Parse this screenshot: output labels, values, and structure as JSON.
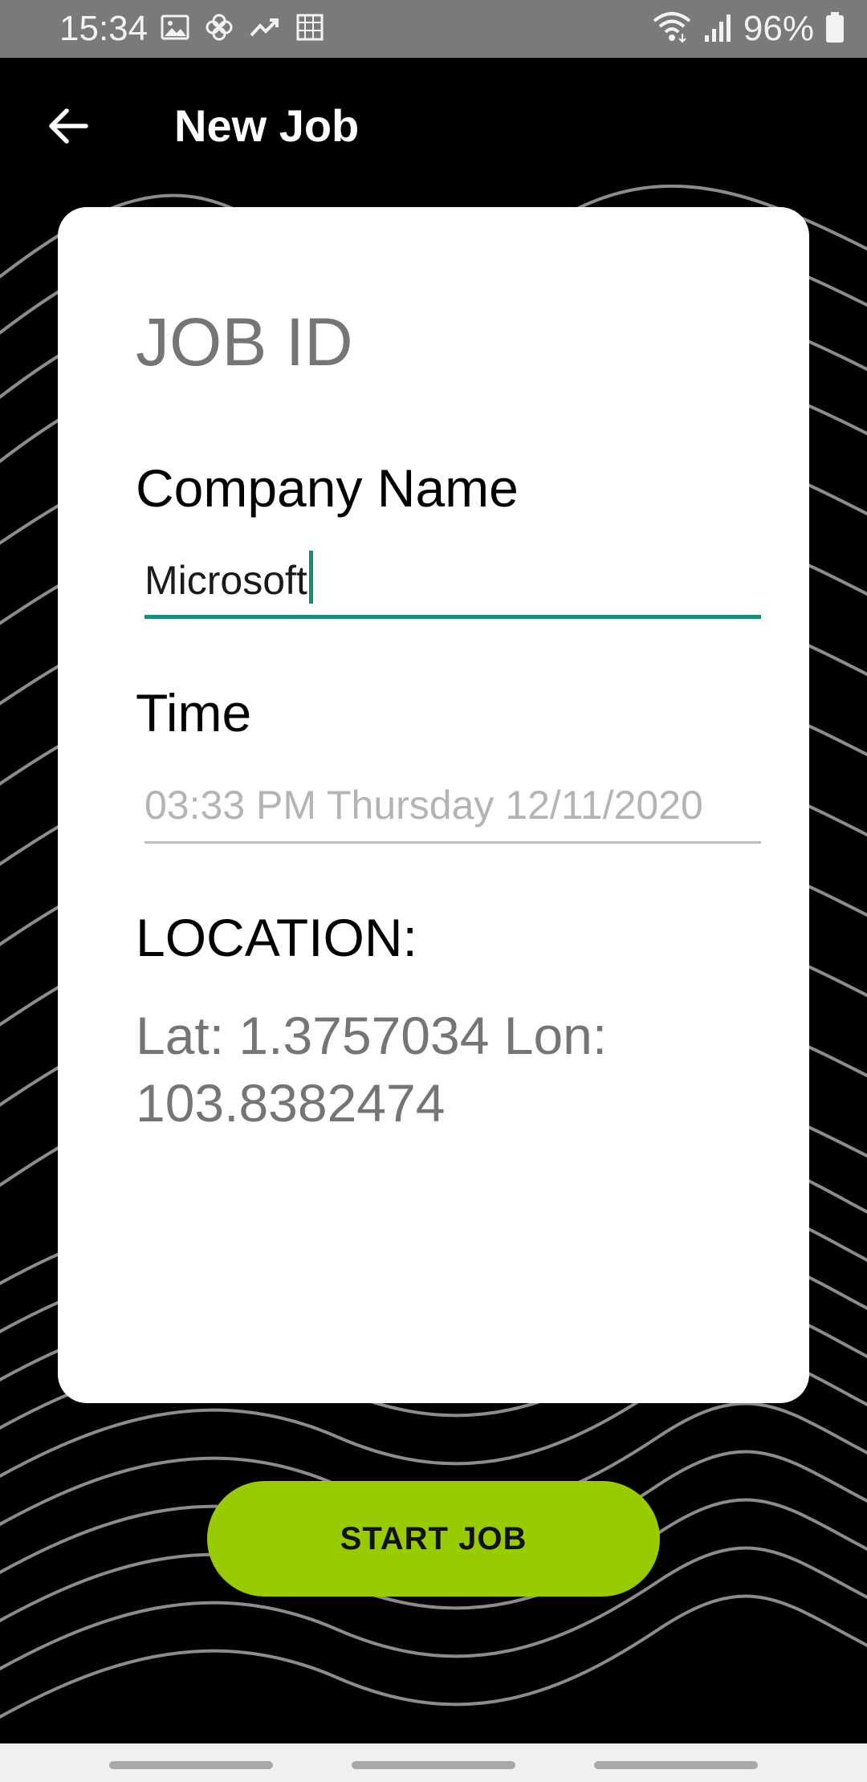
{
  "status_bar": {
    "time": "15:34",
    "battery_percent": "96%",
    "icons_left": [
      "image-icon",
      "pinwheel-icon",
      "trending-icon",
      "screenshot-icon"
    ],
    "icons_right": [
      "wifi-icon",
      "signal-icon",
      "battery-icon"
    ]
  },
  "app_bar": {
    "title": "New Job",
    "back_icon": "arrow-back-icon"
  },
  "card": {
    "job_id": "JOB ID",
    "company_label": "Company Name",
    "company_value": "Microsoft",
    "time_label": "Time",
    "time_value": "03:33 PM Thursday 12/11/2020",
    "location_label": "LOCATION:",
    "location_value": "Lat: 1.3757034 Lon: 103.8382474"
  },
  "actions": {
    "start_label": "START JOB"
  },
  "colors": {
    "background": "#000000",
    "card": "#ffffff",
    "accent": "#1a8a7a",
    "button": "#99cc00",
    "muted_text": "#757575"
  }
}
